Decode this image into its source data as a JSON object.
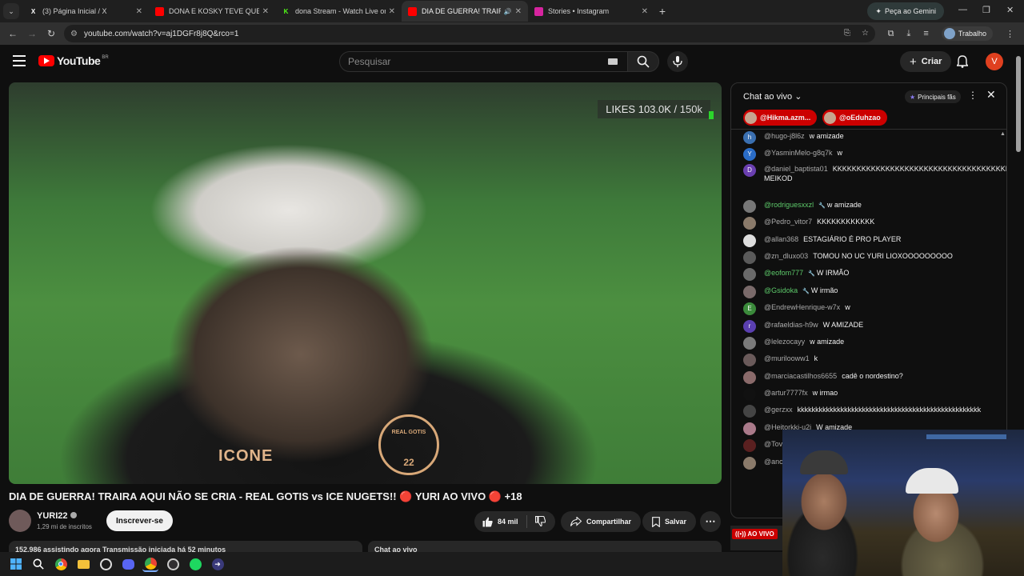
{
  "browser": {
    "tabs": [
      {
        "title": "(3) Página Inicial / X",
        "icon": "x-logo-icon",
        "fav": "X",
        "color": "#000000",
        "active": false
      },
      {
        "title": "DONA E KOSKY TEVE QUE INTE",
        "icon": "youtube-icon",
        "fav": "",
        "color": "#ff0000",
        "active": false
      },
      {
        "title": "dona Stream - Watch Live on K",
        "icon": "kick-icon",
        "fav": "K",
        "color": "#53fc18",
        "active": false
      },
      {
        "title": "DIA DE GUERRA! TRAIRA A",
        "icon": "youtube-icon",
        "fav": "",
        "color": "#ff0000",
        "active": true
      },
      {
        "title": "Stories • Instagram",
        "icon": "instagram-icon",
        "fav": "",
        "color": "#d6249f",
        "active": false
      }
    ],
    "gemini_label": "Peça ao Gemini",
    "url": "youtube.com/watch?v=aj1DGFr8j8Q&rco=1",
    "profile_label": "Trabalho"
  },
  "header": {
    "logo_text": "YouTube",
    "country": "BR",
    "search_placeholder": "Pesquisar",
    "create_label": "Criar",
    "avatar_letter": "V"
  },
  "video": {
    "likes_label": "LIKES",
    "likes_value": "103.0K",
    "likes_sep": "/",
    "likes_goal": "150k",
    "jersey_text": "ICONE",
    "badge_text": "22",
    "badge_title": "REAL GOTIS",
    "title": "DIA DE GUERRA! TRAIRA AQUI NÃO SE CRIA - REAL GOTIS vs ICE NUGETS!! 🔴 YURI AO VIVO 🔴 +18"
  },
  "channel": {
    "name": "YURI22",
    "subs": "1,29 mi de inscritos",
    "subscribe_label": "Inscrever-se"
  },
  "actions": {
    "likes": "84 mil",
    "share": "Compartilhar",
    "save": "Salvar"
  },
  "below": {
    "desc": "152.986 assistindo agora  Transmissão iniciada há 52 minutos",
    "chat_label": "Chat ao vivo"
  },
  "chat": {
    "mode": "Chat ao vivo",
    "top_fans": "Principais fãs",
    "pinned": [
      "@Hikma.azm...",
      "@oEduhzao"
    ],
    "messages": [
      {
        "author": "@hugo-j8l6z",
        "text": "w amizade",
        "avatar": "h",
        "color": "#3a6fb0",
        "mod": false
      },
      {
        "author": "@YasminMelo-g8q7k",
        "text": "w",
        "avatar": "Y",
        "color": "#2a6cc7",
        "mod": false
      },
      {
        "author": "@daniel_baptista01",
        "text": "KKKKKKKKKKKKKKKKKKKKKKKKKKKKKKKKKKKKKKKKKKKKKKKKKKKKKKKKKKKKK MEIKOD",
        "avatar": "D",
        "color": "#6a3fb0",
        "mod": false
      },
      {
        "author": "@rodriguesxxzl",
        "text": "w amizade",
        "avatar": "",
        "color": "#777777",
        "mod": true
      },
      {
        "author": "@Pedro_vitor7",
        "text": "KKKKKKKKKKKK",
        "avatar": "",
        "color": "#8a7a6a",
        "mod": false
      },
      {
        "author": "@allan368",
        "text": "ESTAGIÁRIO É PRO PLAYER",
        "avatar": "",
        "color": "#dddddd",
        "mod": false
      },
      {
        "author": "@zn_dluxo03",
        "text": "TOMOU NO UC YURI LIOXOOOOOOOOO",
        "avatar": "",
        "color": "#5a5a5a",
        "mod": false
      },
      {
        "author": "@eofom777",
        "text": "W IRMÃO",
        "avatar": "",
        "color": "#6a6a6a",
        "mod": true
      },
      {
        "author": "@Gsidoka",
        "text": "W irmão",
        "avatar": "",
        "color": "#7a6a6a",
        "mod": true
      },
      {
        "author": "@EndrewHenrique-w7x",
        "text": "w",
        "avatar": "E",
        "color": "#3b8a3b",
        "mod": false
      },
      {
        "author": "@rafaeldias-h9w",
        "text": "W AMIZADE",
        "avatar": "r",
        "color": "#5a3fb0",
        "mod": false
      },
      {
        "author": "@lelezocayy",
        "text": "w amizade",
        "avatar": "",
        "color": "#7a7a7a",
        "mod": false
      },
      {
        "author": "@murilooww1",
        "text": "k",
        "avatar": "",
        "color": "#6a5a5a",
        "mod": false
      },
      {
        "author": "@marciacastilhos6655",
        "text": "cadê o nordestino?",
        "avatar": "",
        "color": "#8a6a6a",
        "mod": false
      },
      {
        "author": "@artur7777fx",
        "text": "w irmao",
        "avatar": "",
        "color": "#111111",
        "mod": false
      },
      {
        "author": "@gerzxx",
        "text": "kkkkkkkkkkkkkkkkkkkkkkkkkkkkkkkkkkkkkkkkkkkkkkkkkkk",
        "avatar": "",
        "color": "#444444",
        "mod": false
      },
      {
        "author": "@Heitorkkj-u2j",
        "text": "W amizade",
        "avatar": "",
        "color": "#aa7a8a",
        "mod": false
      },
      {
        "author": "@Tov",
        "text": "",
        "avatar": "",
        "color": "#5a2020",
        "mod": false
      },
      {
        "author": "@anc",
        "text": "",
        "avatar": "",
        "color": "#8a7a6a",
        "mod": false
      }
    ]
  },
  "side": {
    "live_badge": "AO VIVO"
  }
}
